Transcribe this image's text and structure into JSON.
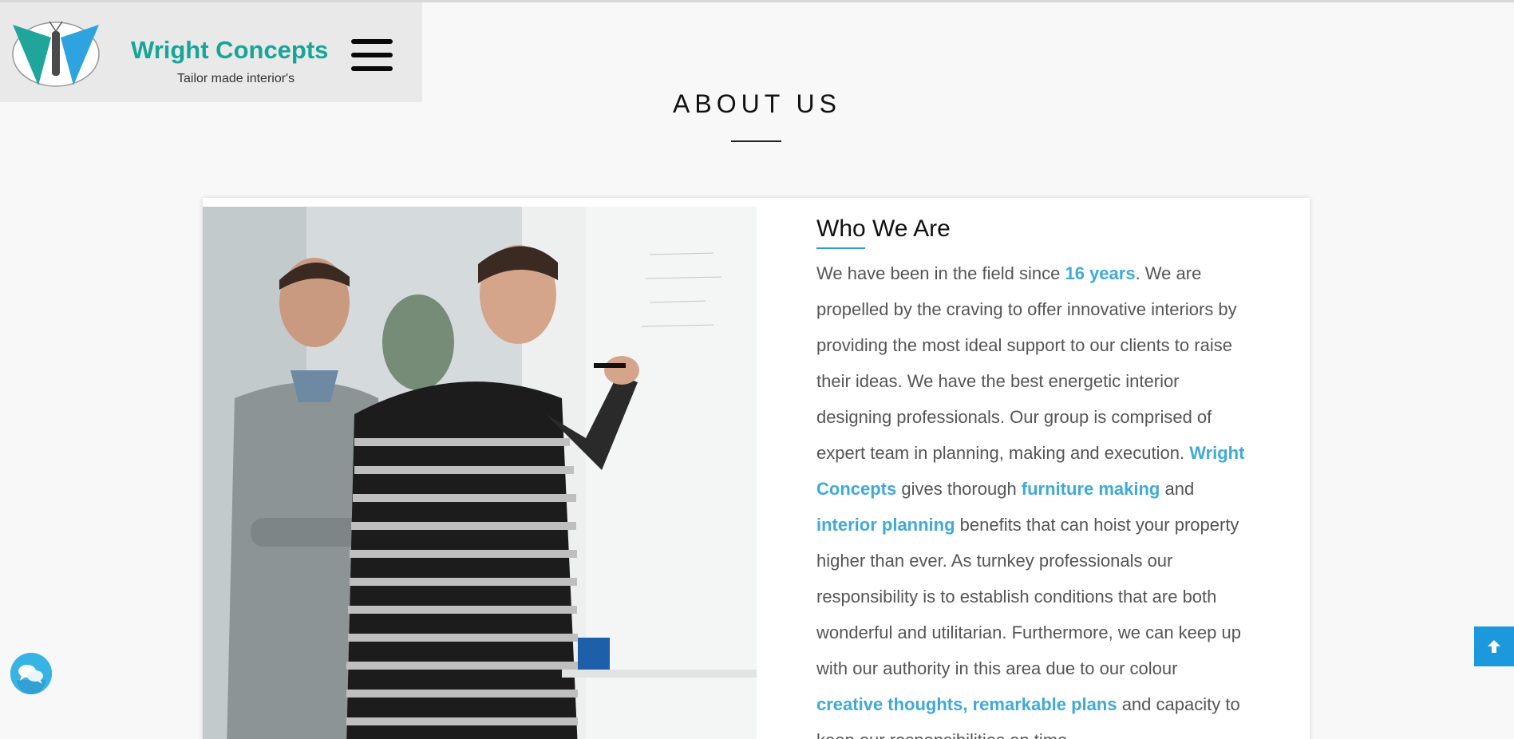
{
  "header": {
    "brand_name": "Wright Concepts",
    "tagline": "Tailor made interior's",
    "logo_icon": "butterfly-logo",
    "menu_icon": "hamburger-menu-icon"
  },
  "section": {
    "title": "ABOUT US"
  },
  "about": {
    "heading": "Who We Are",
    "p1_a": "We have been in the field since ",
    "p1_hl": "16 years",
    "p1_b": ". We are propelled by the craving to offer innovative interiors by providing the most ideal support to our clients to raise their ideas. We have the best energetic interior designing professionals. Our group is comprised of expert team in planning, making and execution.",
    "p2_hl1": "Wright Concepts",
    "p2_a": " gives thorough ",
    "p2_hl2": "furniture making",
    "p2_b": " and ",
    "p2_hl3": "interior planning",
    "p2_c": " benefits that can hoist your property higher than ever. As turnkey professionals our responsibility is to establish conditions that are both wonderful and utilitarian. Furthermore, we can keep up with our authority in this area due to our colour ",
    "p2_hl4": "creative thoughts, remarkable plans",
    "p2_d": " and capacity to keep our responsibilities on time."
  },
  "floating": {
    "chat_icon": "chat-bubbles-icon",
    "scroll_top_icon": "arrow-up-icon"
  },
  "colors": {
    "brand_teal": "#17a597",
    "highlight_blue": "#3fa9d8",
    "scroll_top_bg": "#1c98dc",
    "chat_bg": "#38b3e6"
  }
}
